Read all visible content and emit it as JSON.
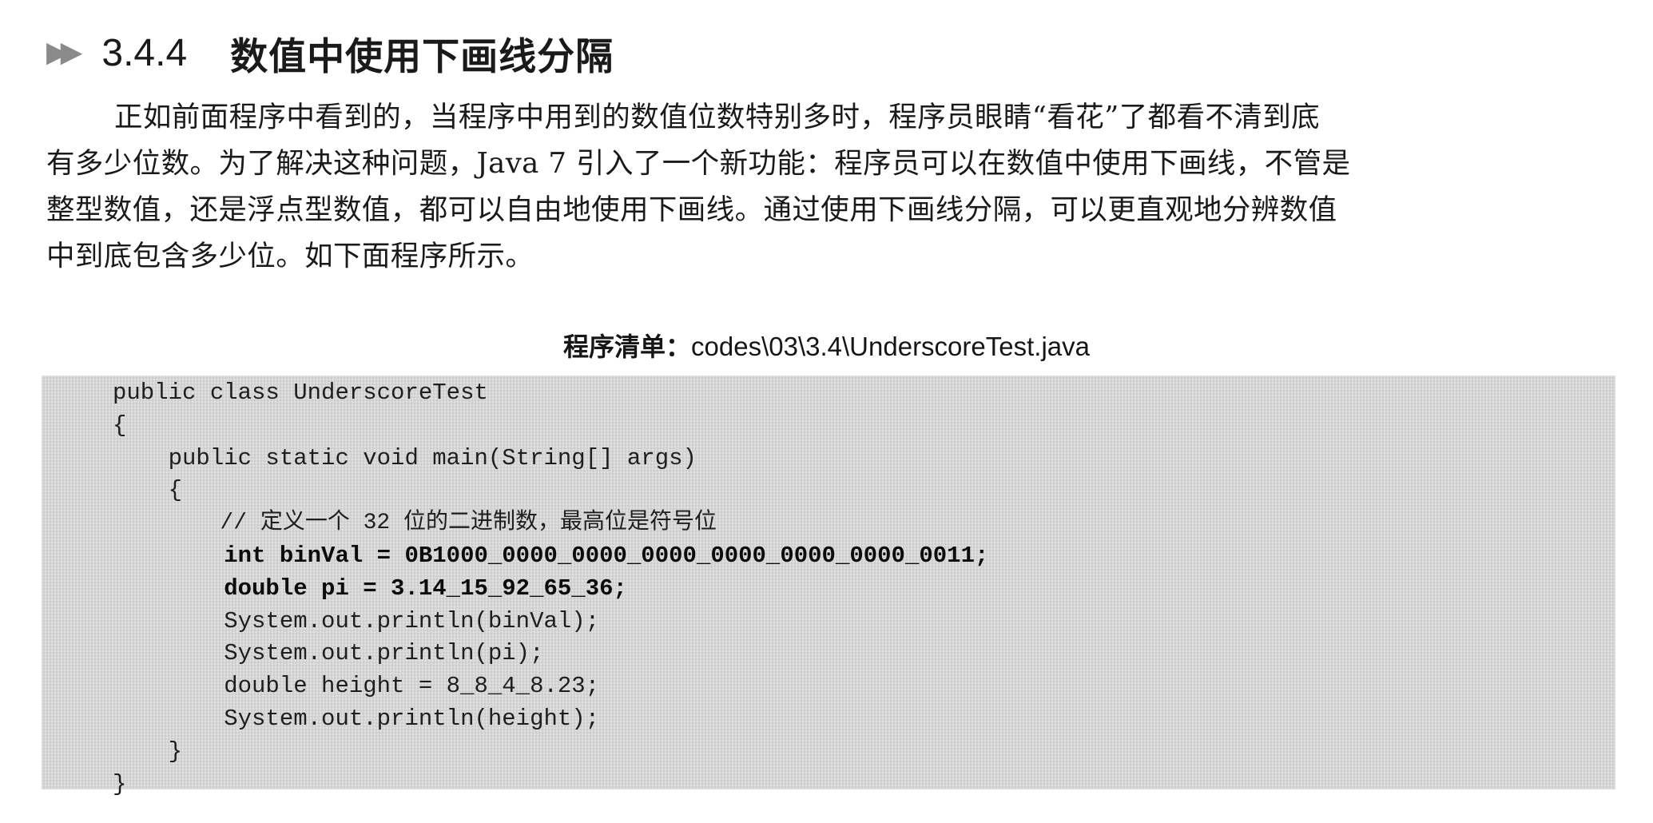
{
  "heading": {
    "marker": "▶▶",
    "number": "3.4.4",
    "title": "数值中使用下画线分隔"
  },
  "paragraph": {
    "lines": [
      "正如前面程序中看到的，当程序中用到的数值位数特别多时，程序员眼睛“看花”了都看不清到底",
      "有多少位数。为了解决这种问题，Java 7 引入了一个新功能：程序员可以在数值中使用下画线，不管是",
      "整型数值，还是浮点型数值，都可以自由地使用下画线。通过使用下画线分隔，可以更直观地分辨数值",
      "中到底包含多少位。如下面程序所示。"
    ]
  },
  "listing": {
    "caption_label": "程序清单：",
    "caption_path": "codes\\03\\3.4\\UnderscoreTest.java",
    "lines": [
      "public class UnderscoreTest",
      "{",
      "    public static void main(String[] args)",
      "    {",
      "        // 定义一个 32 位的二进制数，最高位是符号位",
      "        int binVal = 0B1000_0000_0000_0000_0000_0000_0000_0011;",
      "        double pi = 3.14_15_92_65_36;",
      "        System.out.println(binVal);",
      "        System.out.println(pi);",
      "        double height = 8_8_4_8.23;",
      "        System.out.println(height);",
      "    }",
      "}"
    ]
  }
}
